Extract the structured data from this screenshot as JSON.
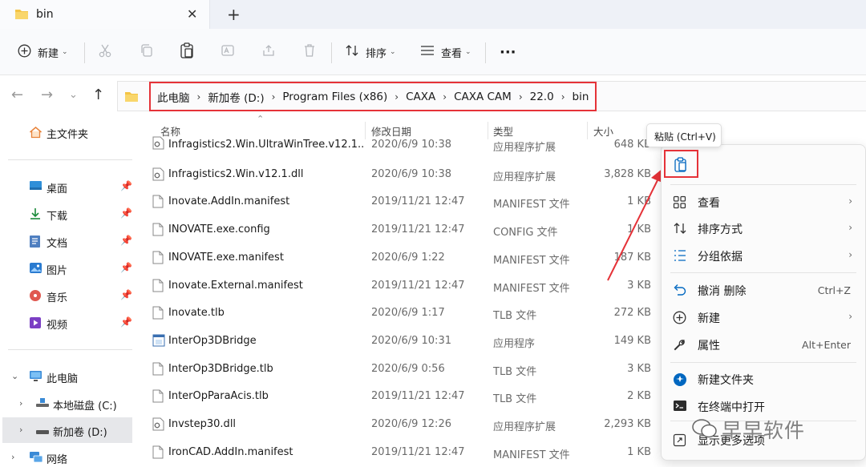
{
  "tab": {
    "title": "bin"
  },
  "toolbar": {
    "new_label": "新建",
    "sort_label": "排序",
    "view_label": "查看",
    "more_label": "···"
  },
  "breadcrumb": [
    "此电脑",
    "新加卷 (D:)",
    "Program Files (x86)",
    "CAXA",
    "CAXA CAM",
    "22.0",
    "bin"
  ],
  "sidebar": {
    "home": "主文件夹",
    "quick": [
      {
        "label": "桌面",
        "icon": "desktop-icon"
      },
      {
        "label": "下载",
        "icon": "download-icon"
      },
      {
        "label": "文档",
        "icon": "document-icon"
      },
      {
        "label": "图片",
        "icon": "pictures-icon"
      },
      {
        "label": "音乐",
        "icon": "music-icon"
      },
      {
        "label": "视频",
        "icon": "video-icon"
      }
    ],
    "this_pc": "此电脑",
    "drive_c": "本地磁盘 (C:)",
    "drive_d": "新加卷 (D:)",
    "network": "网络"
  },
  "columns": {
    "name": "名称",
    "date": "修改日期",
    "type": "类型",
    "size": "大小"
  },
  "files": [
    {
      "name": "Infragistics2.Win.UltraWinTree.v12.1....",
      "date": "2020/6/9 10:38",
      "type": "应用程序扩展",
      "size": "648 KB",
      "kind": "dll"
    },
    {
      "name": "Infragistics2.Win.v12.1.dll",
      "date": "2020/6/9 10:38",
      "type": "应用程序扩展",
      "size": "3,828 KB",
      "kind": "dll"
    },
    {
      "name": "Inovate.AddIn.manifest",
      "date": "2019/11/21 12:47",
      "type": "MANIFEST 文件",
      "size": "1 KB",
      "kind": "file"
    },
    {
      "name": "INOVATE.exe.config",
      "date": "2019/11/21 12:47",
      "type": "CONFIG 文件",
      "size": "1 KB",
      "kind": "file"
    },
    {
      "name": "INOVATE.exe.manifest",
      "date": "2020/6/9 1:22",
      "type": "MANIFEST 文件",
      "size": "187 KB",
      "kind": "file"
    },
    {
      "name": "Inovate.External.manifest",
      "date": "2019/11/21 12:47",
      "type": "MANIFEST 文件",
      "size": "3 KB",
      "kind": "file"
    },
    {
      "name": "Inovate.tlb",
      "date": "2020/6/9 1:17",
      "type": "TLB 文件",
      "size": "272 KB",
      "kind": "file"
    },
    {
      "name": "InterOp3DBridge",
      "date": "2020/6/9 10:31",
      "type": "应用程序",
      "size": "149 KB",
      "kind": "exe"
    },
    {
      "name": "InterOp3DBridge.tlb",
      "date": "2020/6/9 0:56",
      "type": "TLB 文件",
      "size": "3 KB",
      "kind": "file"
    },
    {
      "name": "InterOpParaAcis.tlb",
      "date": "2019/11/21 12:47",
      "type": "TLB 文件",
      "size": "2 KB",
      "kind": "file"
    },
    {
      "name": "Invstep30.dll",
      "date": "2020/6/9 12:26",
      "type": "应用程序扩展",
      "size": "2,293 KB",
      "kind": "dll"
    },
    {
      "name": "IronCAD.AddIn.manifest",
      "date": "2019/11/21 12:47",
      "type": "MANIFEST 文件",
      "size": "1 KB",
      "kind": "file"
    }
  ],
  "context_menu": {
    "tooltip": "粘贴 (Ctrl+V)",
    "items": [
      {
        "label": "查看",
        "icon": "grid-icon",
        "arrow": true
      },
      {
        "label": "排序方式",
        "icon": "sort-icon",
        "arrow": true
      },
      {
        "label": "分组依据",
        "icon": "group-icon",
        "arrow": true
      },
      {
        "label": "撤消 删除",
        "icon": "undo-icon",
        "shortcut": "Ctrl+Z"
      },
      {
        "label": "新建",
        "icon": "plus-circle-icon",
        "arrow": true
      },
      {
        "label": "属性",
        "icon": "wrench-icon",
        "shortcut": "Alt+Enter"
      },
      {
        "label": "新建文件夹",
        "icon": "new-folder-icon"
      },
      {
        "label": "在终端中打开",
        "icon": "terminal-icon"
      },
      {
        "label": "显示更多选项",
        "icon": "expand-icon"
      }
    ]
  },
  "watermark": "早早软件",
  "colors": {
    "highlight": "#e53238",
    "accent": "#0067c0",
    "folder": "#f4c445"
  }
}
